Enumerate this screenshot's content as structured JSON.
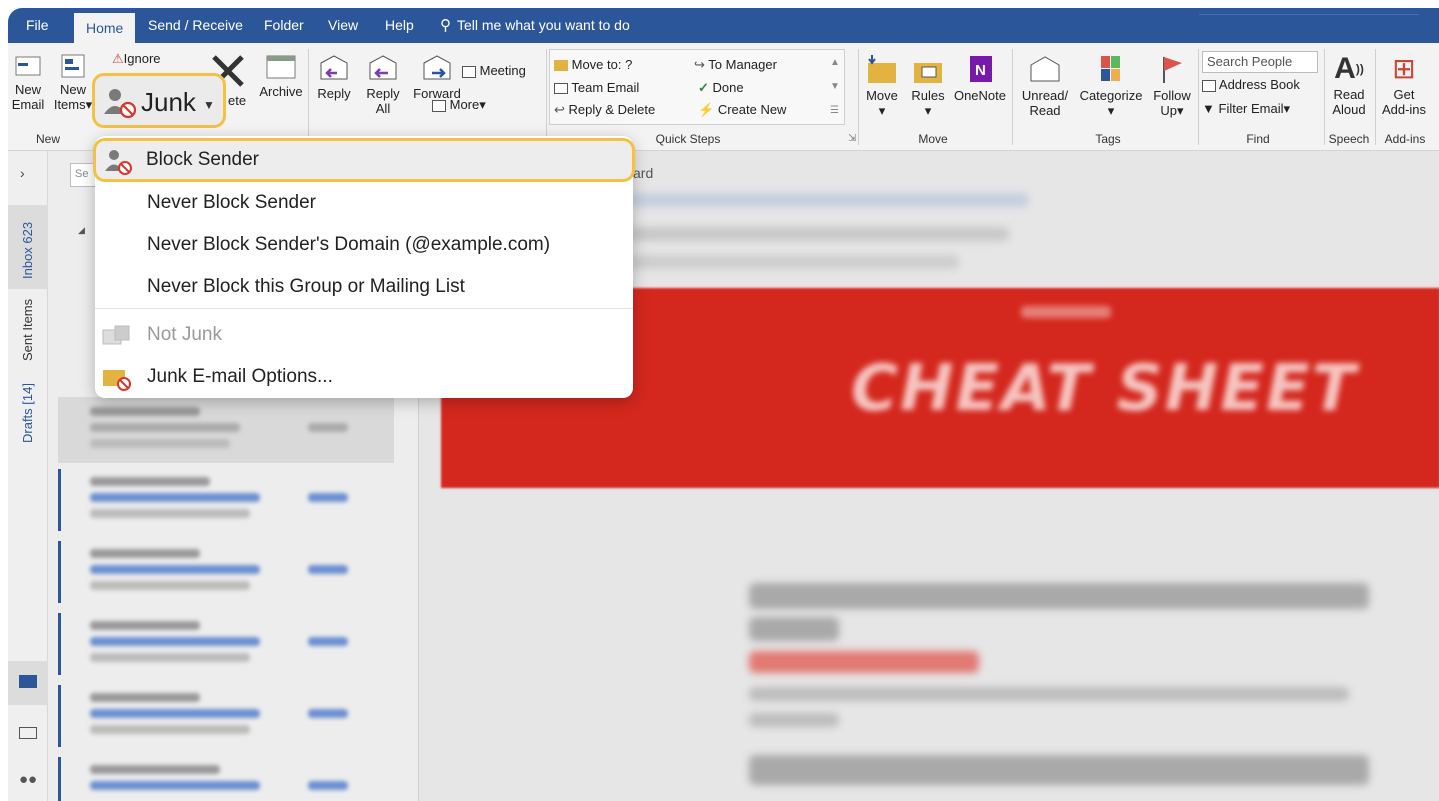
{
  "tabs": [
    "File",
    "Home",
    "Send / Receive",
    "Folder",
    "View",
    "Help"
  ],
  "tell_me": "Tell me what you want to do",
  "ribbon": {
    "new_email": [
      "New",
      "Email"
    ],
    "new_items": [
      "New",
      "Items"
    ],
    "ignore": "Ignore",
    "junk": "Junk",
    "delete_partial": "ete",
    "archive": "Archive",
    "reply": "Reply",
    "reply_all": [
      "Reply",
      "All"
    ],
    "forward": "Forward",
    "meeting": "Meeting",
    "more": "More",
    "quick_steps": {
      "move_to": "Move to: ?",
      "team_email": "Team Email",
      "reply_delete": "Reply & Delete",
      "to_manager": "To Manager",
      "done": "Done",
      "create_new": "Create New"
    },
    "move": "Move",
    "rules": "Rules",
    "onenote": "OneNote",
    "unread_read": [
      "Unread/",
      "Read"
    ],
    "categorize": "Categorize",
    "follow_up": [
      "Follow",
      "Up"
    ],
    "search_people": "Search People",
    "address_book": "Address Book",
    "filter_email": "Filter Email",
    "read_aloud": [
      "Read",
      "Aloud"
    ],
    "get_addins": [
      "Get",
      "Add-ins"
    ],
    "groups": {
      "new": "New",
      "quick_steps": "Quick Steps",
      "move": "Move",
      "tags": "Tags",
      "find": "Find",
      "speech": "Speech",
      "addins": "Add-ins"
    }
  },
  "leftnav": {
    "inbox": "Inbox",
    "inbox_count": "623",
    "sent_items": "Sent Items",
    "drafts": "Drafts",
    "drafts_count": "[14]"
  },
  "msglist": {
    "search_partial": "Se"
  },
  "reading": {
    "header_partial": "ard",
    "banner": "CHEAT SHEET"
  },
  "junk_menu": {
    "block_sender": "Block Sender",
    "never_block_sender": "Never Block Sender",
    "never_block_domain": "Never Block Sender's Domain (@example.com)",
    "never_block_group": "Never Block this Group or Mailing List",
    "not_junk": "Not Junk",
    "junk_options": "Junk E-mail Options..."
  },
  "colors": {
    "accent": "#2b579a",
    "highlight": "#f5c142",
    "banner": "#d4281e"
  }
}
